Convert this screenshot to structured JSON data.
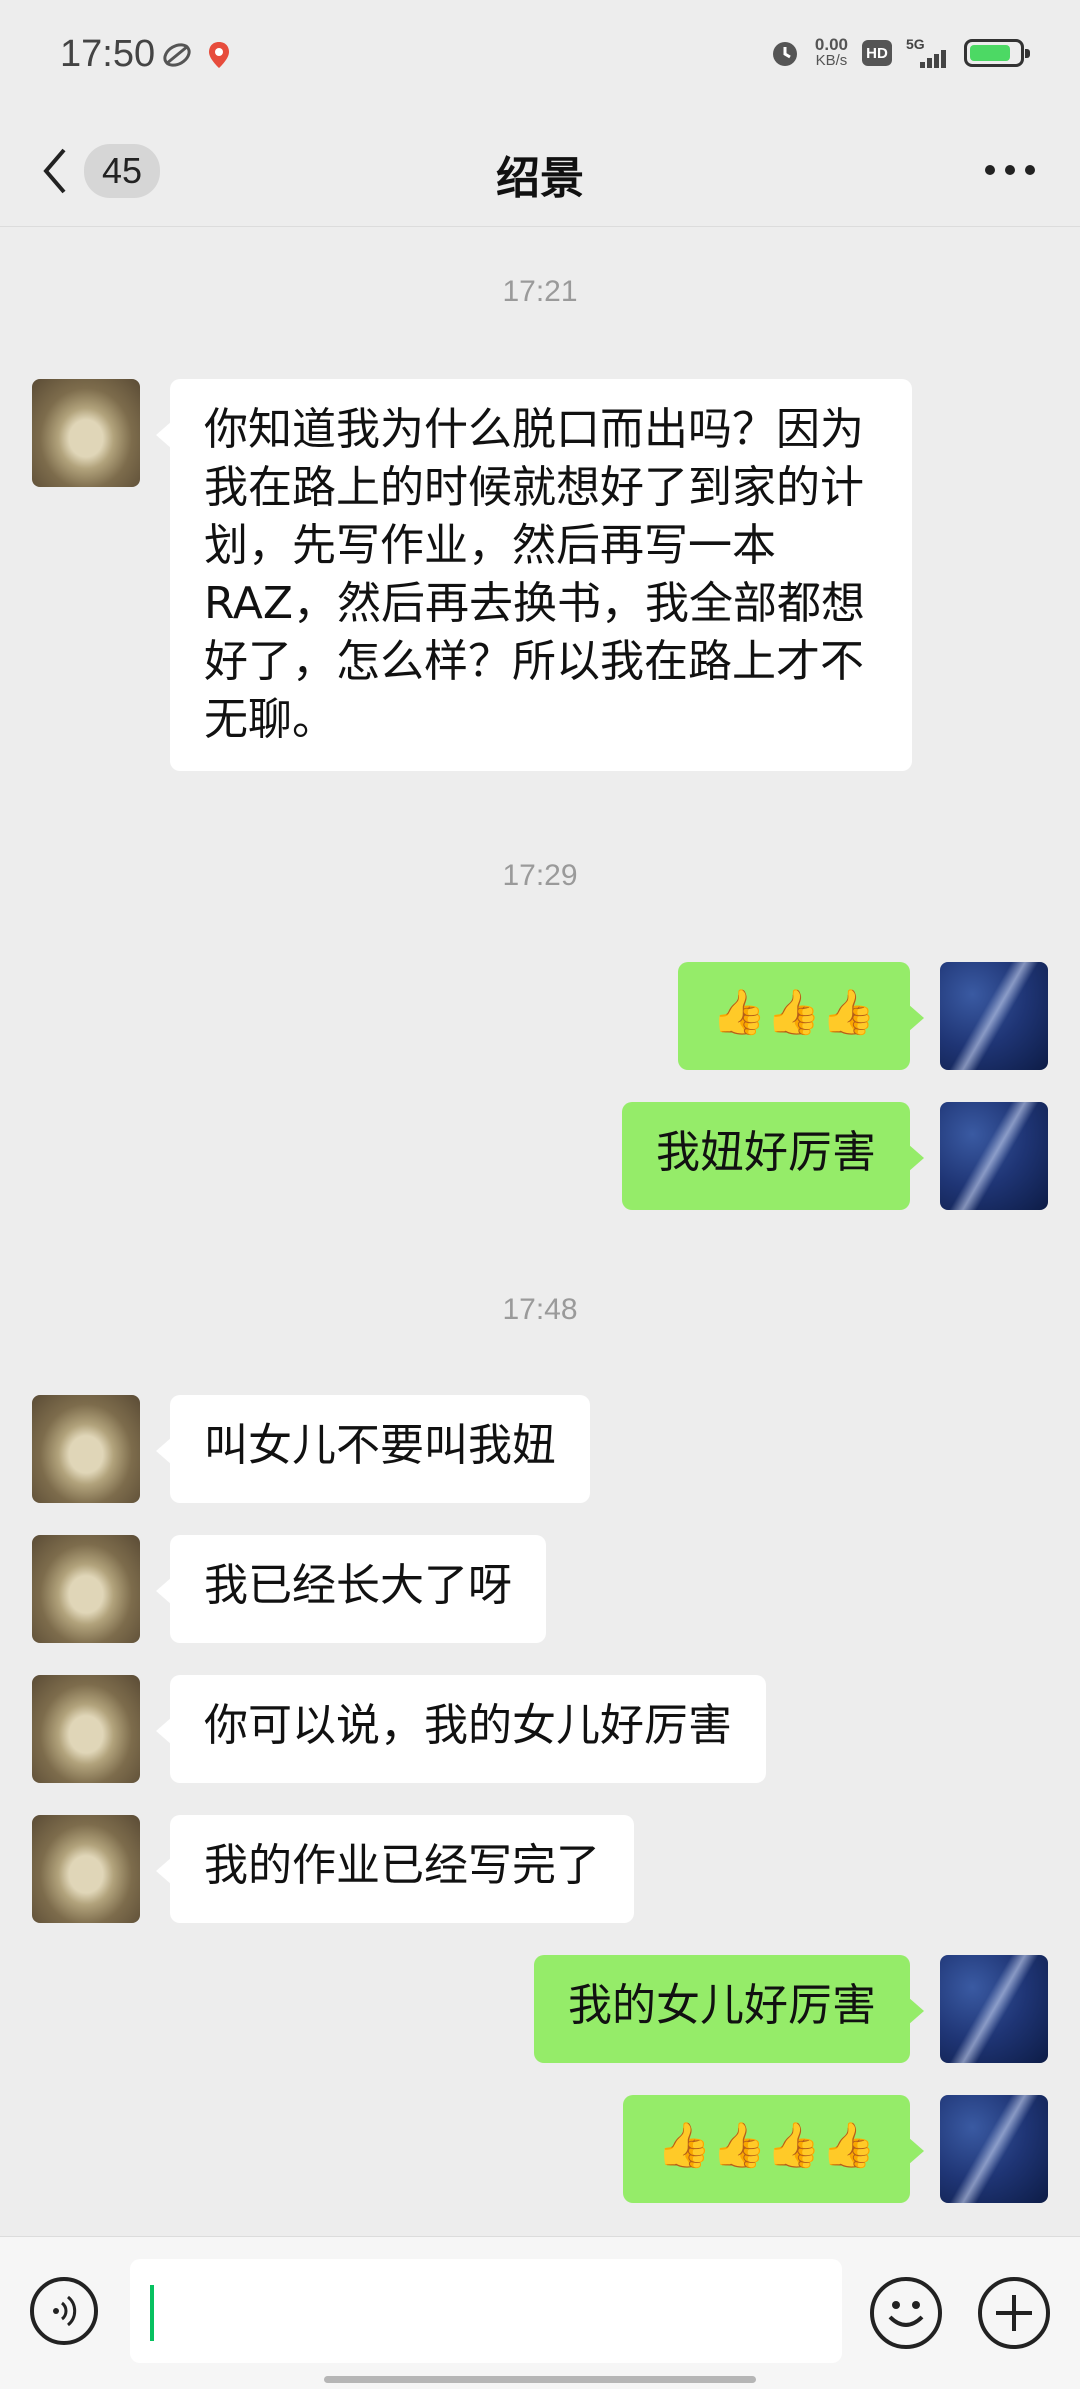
{
  "status_bar": {
    "time": "17:50",
    "net_speed_value": "0.00",
    "net_speed_unit": "KB/s",
    "hd_label": "HD",
    "network_label": "5G"
  },
  "nav": {
    "unread_count": "45",
    "title": "绍景"
  },
  "messages": {
    "t1": "17:21",
    "m1": "你知道我为什么脱口而出吗？因为我在路上的时候就想好了到家的计划，先写作业，然后再写一本RAZ，然后再去换书，我全部都想好了，怎么样？所以我在路上才不无聊。",
    "t2": "17:29",
    "m2": "👍👍👍",
    "m3": "我妞好厉害",
    "t3": "17:48",
    "m4": "叫女儿不要叫我妞",
    "m5": "我已经长大了呀",
    "m6": "你可以说，我的女儿好厉害",
    "m7": "我的作业已经写完了",
    "m8": "我的女儿好厉害",
    "m9": "👍👍👍👍"
  },
  "colors": {
    "outgoing_bubble": "#95ec69",
    "incoming_bubble": "#ffffff",
    "background": "#ededed",
    "caret": "#07c160"
  },
  "icons": {
    "back": "chevron-left-icon",
    "more": "more-dots-icon",
    "voice": "voice-icon",
    "emoji": "emoji-icon",
    "plus": "plus-icon"
  }
}
